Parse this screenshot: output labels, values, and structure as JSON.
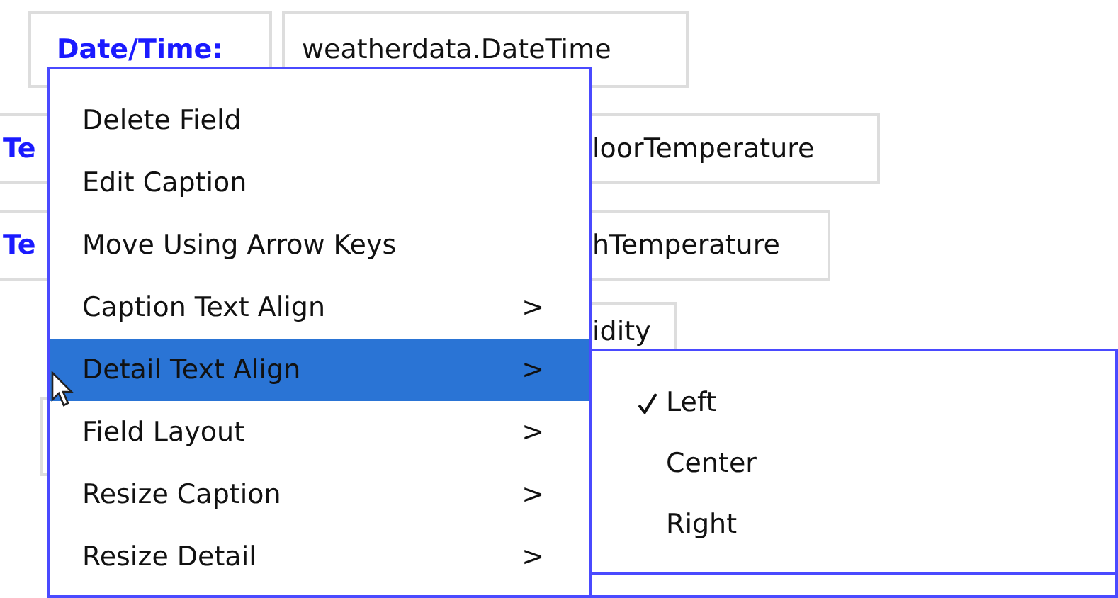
{
  "fields": [
    {
      "caption": "Date/Time:",
      "detail": "weatherdata.DateTime"
    },
    {
      "caption": "Te",
      "detail": "loorTemperature"
    },
    {
      "caption": "Te",
      "detail": "hTemperature"
    },
    {
      "detail": "idity"
    }
  ],
  "context_menu": {
    "items": [
      {
        "label": "Delete Field",
        "selected": false
      },
      {
        "label": "Edit Caption",
        "selected": false
      },
      {
        "label": "Move Using Arrow Keys",
        "selected": false
      },
      {
        "label": "Caption Text Align",
        "arrow": ">",
        "selected": false
      },
      {
        "label": "Detail Text Align",
        "arrow": ">",
        "selected": true
      },
      {
        "label": "Field Layout",
        "arrow": ">",
        "selected": false
      },
      {
        "label": "Resize Caption",
        "arrow": ">",
        "selected": false
      },
      {
        "label": "Resize Detail",
        "arrow": ">",
        "selected": false
      }
    ]
  },
  "submenu": {
    "items": [
      {
        "label": "Left",
        "checked": true
      },
      {
        "label": "Center",
        "checked": false
      },
      {
        "label": "Right",
        "checked": false
      }
    ]
  }
}
